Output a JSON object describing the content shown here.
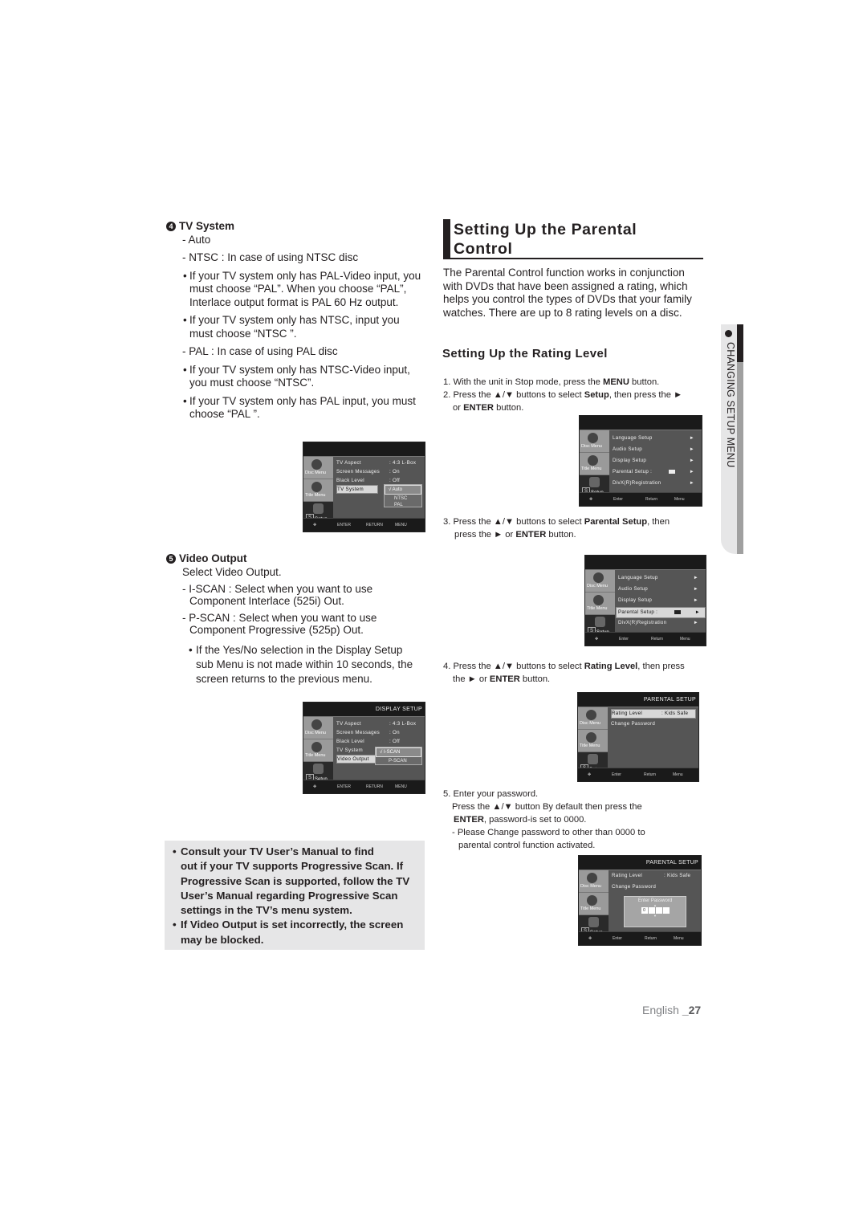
{
  "left": {
    "tv_system": {
      "num": "4",
      "heading": "TV System",
      "auto": "- Auto",
      "ntsc": "- NTSC : In case of using NTSC disc",
      "ntsc_b1_l1": "If your TV system only has PAL-Video input, you",
      "ntsc_b1_l2": "must choose “PAL”. When you choose “PAL”,",
      "ntsc_b1_l3": "Interlace output format is PAL 60 Hz output.",
      "ntsc_b2_l1": "If your TV system only has NTSC, input you",
      "ntsc_b2_l2": "must choose “NTSC ”.",
      "pal": "- PAL : In case of using PAL disc",
      "pal_b1_l1": "If your TV system only has NTSC-Video input,",
      "pal_b1_l2": "you must choose “NTSC”.",
      "pal_b2_l1": "If your TV system only has PAL input, you must",
      "pal_b2_l2": "choose “PAL ”."
    },
    "screen1": {
      "title": "",
      "tabs": [
        "Disc Menu",
        "Title Menu",
        "Setup"
      ],
      "rows": [
        {
          "label": "TV Aspect",
          "value": ": 4:3 L-Box"
        },
        {
          "label": "Screen Messages",
          "value": ": On"
        },
        {
          "label": "Black Level",
          "value": ": Off"
        },
        {
          "label": "TV System",
          "value": ""
        }
      ],
      "options": [
        "√ Auto",
        "NTSC",
        "PAL"
      ],
      "footer": [
        "ENTER",
        "RETURN",
        "MENU"
      ]
    },
    "video_output": {
      "num": "5",
      "heading": "Video Output",
      "intro": "Select Video Output.",
      "iscan_l1": "- I-SCAN : Select when you want to use",
      "iscan_l2": "Component Interlace (525i) Out.",
      "pscan_l1": "- P-SCAN : Select when you want to use",
      "pscan_l2": "Component Progressive (525p) Out.",
      "b1_l1": "If the Yes/No selection in the Display Setup",
      "b1_l2": "sub Menu is not made within 10 seconds, the",
      "b1_l3": "screen returns to the previous menu."
    },
    "screen2": {
      "title": "DISPLAY SETUP",
      "tabs": [
        "Disc Menu",
        "Title Menu",
        "Setup"
      ],
      "rows": [
        {
          "label": "TV Aspect",
          "value": ": 4:3 L-Box"
        },
        {
          "label": "Screen Messages",
          "value": ": On"
        },
        {
          "label": "Black Level",
          "value": ": Off"
        },
        {
          "label": "TV System",
          "value": ""
        },
        {
          "label": "Video Output",
          "value": ""
        }
      ],
      "options": [
        "√  I-SCAN",
        "P-SCAN"
      ],
      "footer": [
        "ENTER",
        "RETURN",
        "MENU"
      ]
    },
    "note": {
      "l1": "Consult your TV User’s Manual to find",
      "l2": "out if your TV supports Progressive Scan. If",
      "l3": "Progressive Scan is supported, follow the TV",
      "l4": "User’s Manual regarding Progressive Scan",
      "l5": "settings in the TV’s menu system.",
      "l6": "If Video Output is set incorrectly, the screen",
      "l7": "may be blocked."
    }
  },
  "right": {
    "title_l1": "Setting Up the Parental",
    "title_l2": "Control",
    "intro_l1": "The Parental Control function works in conjunction",
    "intro_l2": "with DVDs that have been assigned a rating, which",
    "intro_l3": "helps you control the types of DVDs that your family",
    "intro_l4": "watches. There are up to 8 rating levels on a disc.",
    "subheading": "Setting Up the Rating Level",
    "step1": {
      "pre": "1. With the unit in Stop mode, press the ",
      "bold": "MENU",
      "post": " button."
    },
    "step2": {
      "pre": "2. Press the ▲/▼ buttons to select ",
      "bold": "Setup",
      "post": ", then press the ►",
      "l2pre": "or ",
      "l2bold": "ENTER",
      "l2post": " button."
    },
    "step3": {
      "pre": "3. Press the ▲/▼ buttons to select ",
      "bold": "Parental Setup",
      "post": ", then",
      "l2pre": "press the ► or ",
      "l2bold": "ENTER",
      "l2post": " button."
    },
    "step4": {
      "pre": "4. Press the ▲/▼ buttons to select ",
      "bold": "Rating Level",
      "post": ", then press",
      "l2pre": "the ► or ",
      "l2bold": "ENTER",
      "l2post": " button."
    },
    "step5": {
      "l1": "5. Enter your password.",
      "l2": "Press the ▲/▼ button By default then press the",
      "l3bold": "ENTER",
      "l3post": ", password-is set to 0000.",
      "l4": "- Please Change password to other than 0000 to",
      "l5": "parental control function activated."
    },
    "menu_screen": {
      "tabs": [
        "Disc Menu",
        "Title Menu",
        "Setup"
      ],
      "items": [
        "Language Setup",
        "Audio Setup",
        "Display Setup",
        "Parental Setup :",
        "DivX(R)Registration"
      ],
      "footer": [
        "Enter",
        "Return",
        "Menu"
      ]
    },
    "parental_screen": {
      "title": "PARENTAL SETUP",
      "tabs": [
        "Disc Menu",
        "Title Menu",
        "Setup"
      ],
      "rating_label": "Rating Level",
      "rating_value": ": Kids Safe",
      "change_password": "Change Password",
      "enter_password": "Enter Password",
      "password_first_digit": "0",
      "footer": [
        "Enter",
        "Return",
        "Menu"
      ]
    }
  },
  "side_tab": {
    "label": "CHANGING SETUP MENU"
  },
  "footer": {
    "lang": "English ",
    "page": "_27"
  }
}
